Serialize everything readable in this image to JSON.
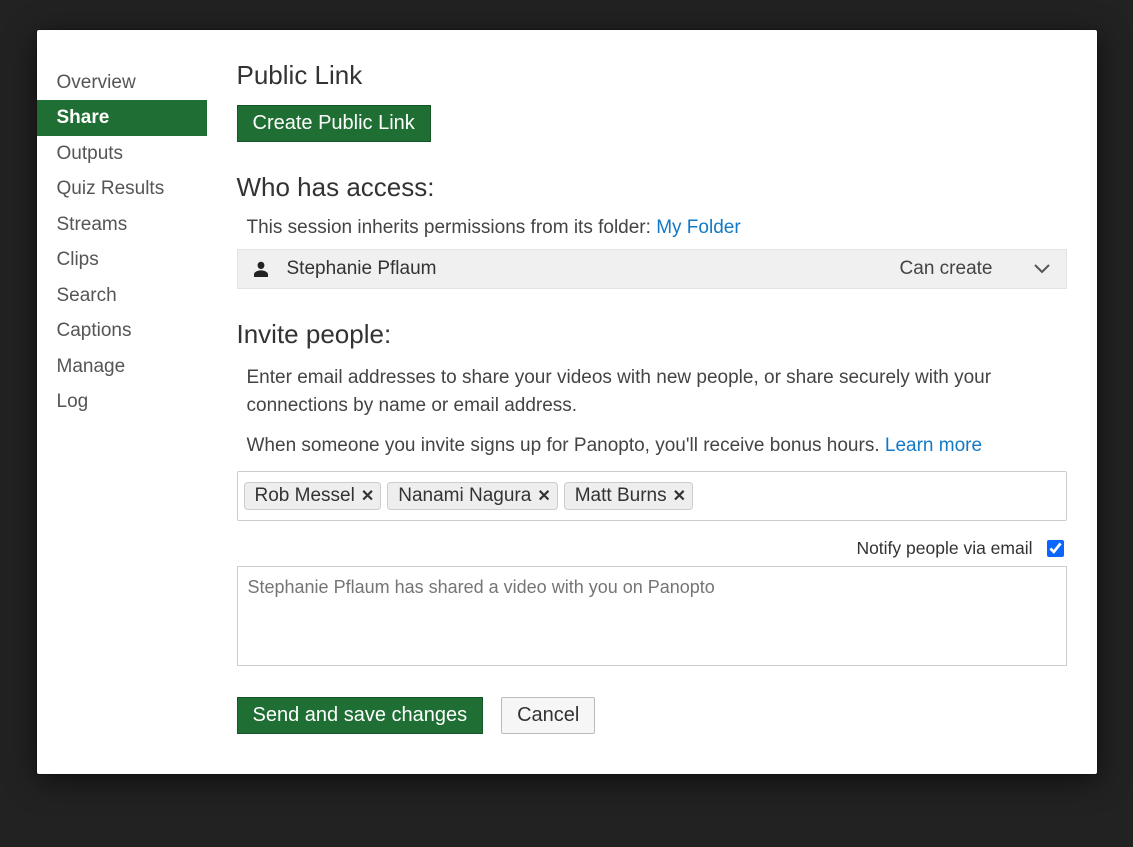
{
  "sidebar": {
    "items": [
      {
        "label": "Overview",
        "active": false
      },
      {
        "label": "Share",
        "active": true
      },
      {
        "label": "Outputs",
        "active": false
      },
      {
        "label": "Quiz Results",
        "active": false
      },
      {
        "label": "Streams",
        "active": false
      },
      {
        "label": "Clips",
        "active": false
      },
      {
        "label": "Search",
        "active": false
      },
      {
        "label": "Captions",
        "active": false
      },
      {
        "label": "Manage",
        "active": false
      },
      {
        "label": "Log",
        "active": false
      }
    ]
  },
  "publicLink": {
    "heading": "Public Link",
    "createButton": "Create Public Link"
  },
  "access": {
    "heading": "Who has access:",
    "inheritText": "This session inherits permissions from its folder: ",
    "folderLink": "My Folder",
    "row": {
      "name": "Stephanie Pflaum",
      "role": "Can create"
    }
  },
  "invite": {
    "heading": "Invite people:",
    "description": "Enter email addresses to share your videos with new people, or share securely with your connections by name or email address.",
    "bonusText": "When someone you invite signs up for Panopto, you'll receive bonus hours.  ",
    "learnMore": "Learn more",
    "chips": [
      {
        "name": "Rob Messel"
      },
      {
        "name": "Nanami Nagura"
      },
      {
        "name": "Matt Burns"
      }
    ],
    "chipRemove": "✕",
    "notifyLabel": "Notify people via email",
    "notifyChecked": true,
    "messagePlaceholder": "Stephanie Pflaum has shared a video with you on Panopto"
  },
  "actions": {
    "primary": "Send and save changes",
    "secondary": "Cancel"
  }
}
